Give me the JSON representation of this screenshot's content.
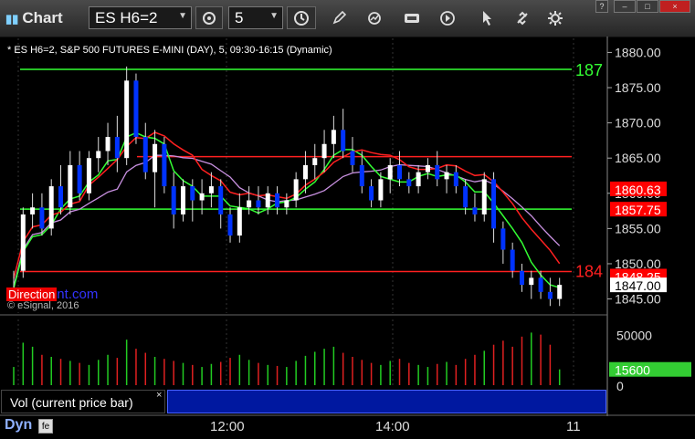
{
  "window": {
    "title": "Chart",
    "symbol": "ES H6=2",
    "interval": "5",
    "controls": [
      "?",
      "–",
      "□",
      "×"
    ]
  },
  "toolbar": {
    "icons": [
      "cursor-icon",
      "draw-pencil-icon",
      "refresh-chart-icon",
      "get-data-icon",
      "play-icon",
      "link-icon",
      "settings-gear-icon"
    ]
  },
  "chart": {
    "header": "* ES H6=2, S&P 500 FUTURES E-MINI (DAY), 5, 09:30-16:15 (Dynamic)",
    "copyright": "© eSignal, 2016",
    "watermark_a": "Direction",
    "watermark_b": "nt.com",
    "line_label_top": "187",
    "line_label_bottom": "184",
    "price_axis": [
      "1880.00",
      "1875.00",
      "1870.00",
      "1865.00",
      "1860.00",
      "1855.00",
      "1850.00",
      "1845.00"
    ],
    "price_tags": [
      {
        "text": "1860.63",
        "fg": "#ffffff",
        "bg": "#ff0000"
      },
      {
        "text": "1857.75",
        "fg": "#ffffff",
        "bg": "#ff0000"
      },
      {
        "text": "1848.25",
        "fg": "#ffffff",
        "bg": "#ff0000"
      },
      {
        "text": "1847.00",
        "fg": "#000000",
        "bg": "#ffffff"
      }
    ],
    "levels": {
      "green_top": 1877.6,
      "green_mid": 1857.75,
      "red_mid": 1865.2,
      "red_low": 1848.9
    },
    "colors": {
      "up": "#ffffff",
      "down": "#0033ff",
      "red": "#ff2020",
      "green": "#33ff33",
      "purple": "#c890e0"
    }
  },
  "volume": {
    "label": "Vol (current price bar)",
    "close_glyph": "×",
    "axis": [
      "50000",
      "0"
    ],
    "tag": "15600",
    "tag_bg": "#33cc33"
  },
  "footer": {
    "dyn": "Dyn",
    "fe": "fe",
    "times": [
      "12:00",
      "14:00",
      "11"
    ]
  },
  "chart_data": {
    "type": "candlestick",
    "ylim": [
      1843,
      1882
    ],
    "candles": [
      [
        1846,
        1849,
        1845,
        1846.5
      ],
      [
        1849,
        1858,
        1848,
        1857
      ],
      [
        1857,
        1860,
        1855,
        1858
      ],
      [
        1858,
        1860,
        1854,
        1855
      ],
      [
        1855,
        1862,
        1854,
        1861
      ],
      [
        1861,
        1864,
        1857,
        1858
      ],
      [
        1858,
        1866,
        1857,
        1864
      ],
      [
        1864,
        1866,
        1859,
        1860
      ],
      [
        1860,
        1866,
        1859,
        1865
      ],
      [
        1865,
        1868,
        1863,
        1866
      ],
      [
        1866,
        1870,
        1864,
        1868
      ],
      [
        1868,
        1871,
        1863,
        1865
      ],
      [
        1865,
        1878,
        1864,
        1876
      ],
      [
        1876,
        1877,
        1867,
        1868
      ],
      [
        1868,
        1870,
        1862,
        1863
      ],
      [
        1863,
        1869,
        1858,
        1867
      ],
      [
        1867,
        1868,
        1860,
        1861
      ],
      [
        1861,
        1863,
        1855,
        1857
      ],
      [
        1857,
        1862,
        1856,
        1861
      ],
      [
        1861,
        1862,
        1856,
        1859
      ],
      [
        1859,
        1862,
        1857,
        1860
      ],
      [
        1860,
        1863,
        1858,
        1861
      ],
      [
        1861,
        1862,
        1855,
        1857
      ],
      [
        1857,
        1858,
        1853,
        1854
      ],
      [
        1854,
        1860,
        1853,
        1858
      ],
      [
        1858,
        1861,
        1857,
        1859
      ],
      [
        1859,
        1861,
        1857,
        1858
      ],
      [
        1858,
        1861,
        1857,
        1860
      ],
      [
        1860,
        1861,
        1857,
        1858
      ],
      [
        1858,
        1860,
        1857,
        1859
      ],
      [
        1859,
        1863,
        1858,
        1862
      ],
      [
        1862,
        1866,
        1860,
        1864
      ],
      [
        1864,
        1867,
        1862,
        1865
      ],
      [
        1865,
        1869,
        1863,
        1867
      ],
      [
        1867,
        1871,
        1865,
        1869
      ],
      [
        1869,
        1872,
        1865,
        1866
      ],
      [
        1866,
        1868,
        1863,
        1864
      ],
      [
        1864,
        1866,
        1860,
        1861
      ],
      [
        1861,
        1862,
        1858,
        1859
      ],
      [
        1859,
        1863,
        1858,
        1862
      ],
      [
        1862,
        1865,
        1860,
        1864
      ],
      [
        1864,
        1866,
        1861,
        1862
      ],
      [
        1862,
        1863,
        1860,
        1861
      ],
      [
        1861,
        1864,
        1860,
        1863
      ],
      [
        1863,
        1865,
        1862,
        1864
      ],
      [
        1864,
        1866,
        1861,
        1862
      ],
      [
        1862,
        1864,
        1860,
        1863
      ],
      [
        1863,
        1864,
        1860,
        1861
      ],
      [
        1861,
        1862,
        1857,
        1858
      ],
      [
        1858,
        1860,
        1856,
        1857
      ],
      [
        1857,
        1863,
        1856,
        1862
      ],
      [
        1862,
        1863,
        1853,
        1855
      ],
      [
        1855,
        1856,
        1850,
        1852
      ],
      [
        1852,
        1853,
        1848,
        1849
      ],
      [
        1849,
        1850,
        1846,
        1847
      ],
      [
        1847,
        1849,
        1845,
        1848
      ],
      [
        1848,
        1849,
        1845,
        1846
      ],
      [
        1846,
        1848,
        1844,
        1845
      ],
      [
        1845,
        1848,
        1844,
        1847
      ]
    ],
    "volume": [
      18000,
      42000,
      38000,
      30000,
      28000,
      26000,
      24000,
      22000,
      20000,
      25000,
      30000,
      27000,
      45000,
      36000,
      32000,
      28000,
      26000,
      24000,
      22000,
      20000,
      18000,
      21000,
      23000,
      27000,
      30000,
      25000,
      22000,
      20000,
      19000,
      18000,
      24000,
      29000,
      33000,
      36000,
      38000,
      32000,
      28000,
      25000,
      22000,
      20000,
      24000,
      26000,
      22000,
      20000,
      18000,
      21000,
      23000,
      20000,
      26000,
      30000,
      34000,
      40000,
      44000,
      38000,
      48000,
      52000,
      50000,
      40000,
      15600
    ]
  }
}
